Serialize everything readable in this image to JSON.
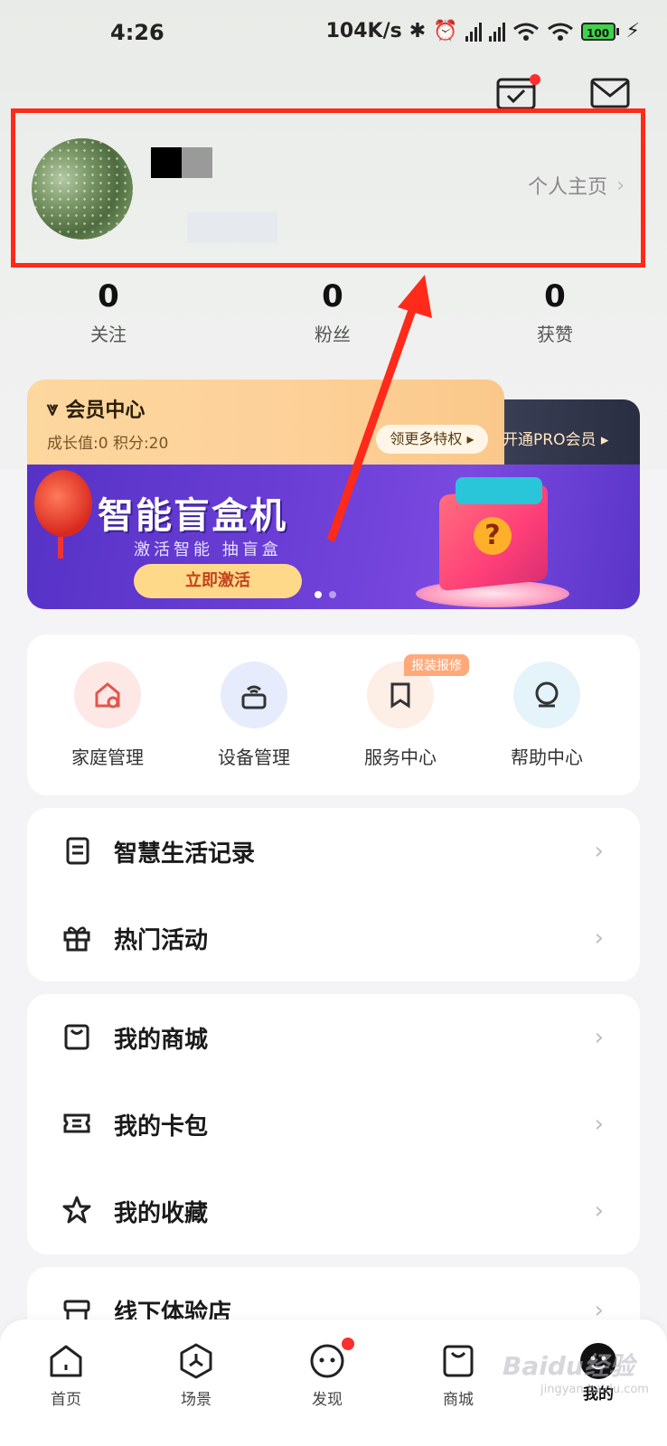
{
  "status_bar": {
    "time": "4:26",
    "net_speed": "104K/s",
    "battery": "100"
  },
  "profile": {
    "link_label": "个人主页",
    "stats": [
      {
        "value": "0",
        "label": "关注"
      },
      {
        "value": "0",
        "label": "粉丝"
      },
      {
        "value": "0",
        "label": "获赞"
      }
    ]
  },
  "member": {
    "title": "会员中心",
    "subtitle": "成长值:0  积分:20",
    "privilege_button": "领更多特权",
    "pro_button": "开通PRO会员"
  },
  "banner": {
    "title": "智能盲盒机",
    "subtitle": "激活智能 抽盲盒",
    "button": "立即激活",
    "slides_total": 2,
    "active_slide": 1
  },
  "quick_actions": [
    {
      "label": "家庭管理",
      "icon": "home-settings-icon",
      "color": "#fde8e6"
    },
    {
      "label": "设备管理",
      "icon": "device-wifi-icon",
      "color": "#e6ecfb"
    },
    {
      "label": "服务中心",
      "icon": "bookmark-icon",
      "color": "#fdeee6",
      "tag": "报装报修"
    },
    {
      "label": "帮助中心",
      "icon": "help-robot-icon",
      "color": "#e5f3fb"
    }
  ],
  "menu_group_1": [
    {
      "label": "智慧生活记录",
      "icon": "document-icon"
    },
    {
      "label": "热门活动",
      "icon": "gift-icon"
    }
  ],
  "menu_group_2": [
    {
      "label": "我的商城",
      "icon": "shopping-bag-icon"
    },
    {
      "label": "我的卡包",
      "icon": "ticket-icon"
    },
    {
      "label": "我的收藏",
      "icon": "star-icon"
    }
  ],
  "menu_group_3": [
    {
      "label": "线下体验店",
      "icon": "store-icon"
    }
  ],
  "bottom_nav": [
    {
      "label": "首页",
      "icon": "home-icon"
    },
    {
      "label": "场景",
      "icon": "scene-icon"
    },
    {
      "label": "发现",
      "icon": "discover-icon",
      "badge": true
    },
    {
      "label": "商城",
      "icon": "mall-bag-icon"
    },
    {
      "label": "我的",
      "icon": "me-icon",
      "active": true
    }
  ],
  "watermark": {
    "text": "Baidu经验",
    "sub": "jingyan.baidu.com"
  },
  "colors": {
    "highlight_box": "#ff2a1a",
    "badge_red": "#ff2d2d",
    "member_gold": "#fcd79e",
    "banner_purple": "#6c3fd6"
  }
}
